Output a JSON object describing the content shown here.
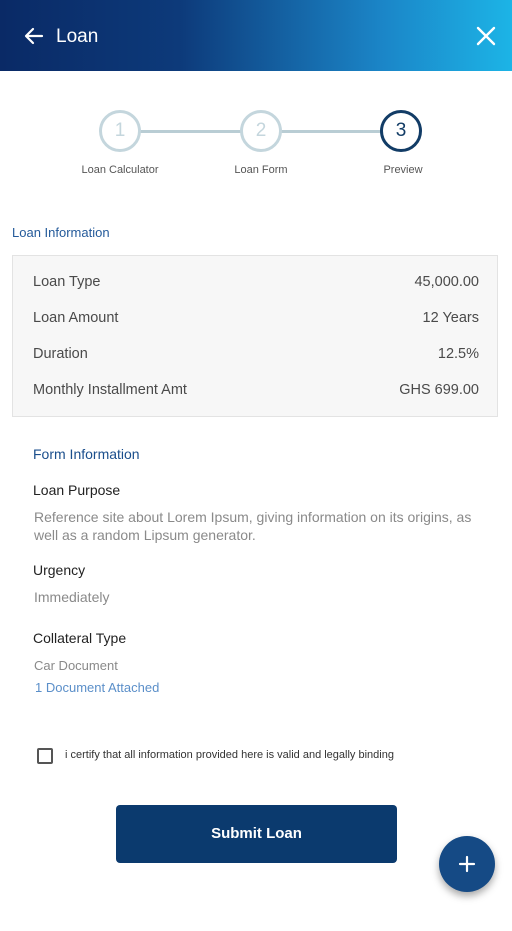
{
  "header": {
    "title": "Loan",
    "back_icon": "arrow-left-icon",
    "close_icon": "close-icon"
  },
  "stepper": {
    "steps": [
      {
        "number": "1",
        "label": "Loan Calculator",
        "state": "inactive"
      },
      {
        "number": "2",
        "label": "Loan Form",
        "state": "inactive"
      },
      {
        "number": "3",
        "label": "Preview",
        "state": "active"
      }
    ]
  },
  "loan_info": {
    "title": "Loan Information",
    "rows": [
      {
        "label": "Loan Type",
        "value": "45,000.00"
      },
      {
        "label": "Loan Amount",
        "value": "12 Years"
      },
      {
        "label": "Duration",
        "value": "12.5%"
      },
      {
        "label": "Monthly Installment Amt",
        "value": "GHS 699.00"
      }
    ]
  },
  "form_info": {
    "title": "Form Information",
    "loan_purpose_label": "Loan Purpose",
    "loan_purpose_value": "Reference site about Lorem Ipsum, giving information on its origins, as well as a random Lipsum generator.",
    "urgency_label": "Urgency",
    "urgency_value": "Immediately",
    "collateral_label": "Collateral Type",
    "collateral_value": "Car Document",
    "attachment_link": "1 Document Attached"
  },
  "certify": {
    "text": "i certify that all information provided here is valid and legally binding",
    "checked": false
  },
  "submit_label": "Submit Loan",
  "fab_icon": "plus-icon",
  "colors": {
    "primary": "#0b3a6e",
    "accent": "#1cb4e6",
    "link": "#5b8fc9"
  }
}
